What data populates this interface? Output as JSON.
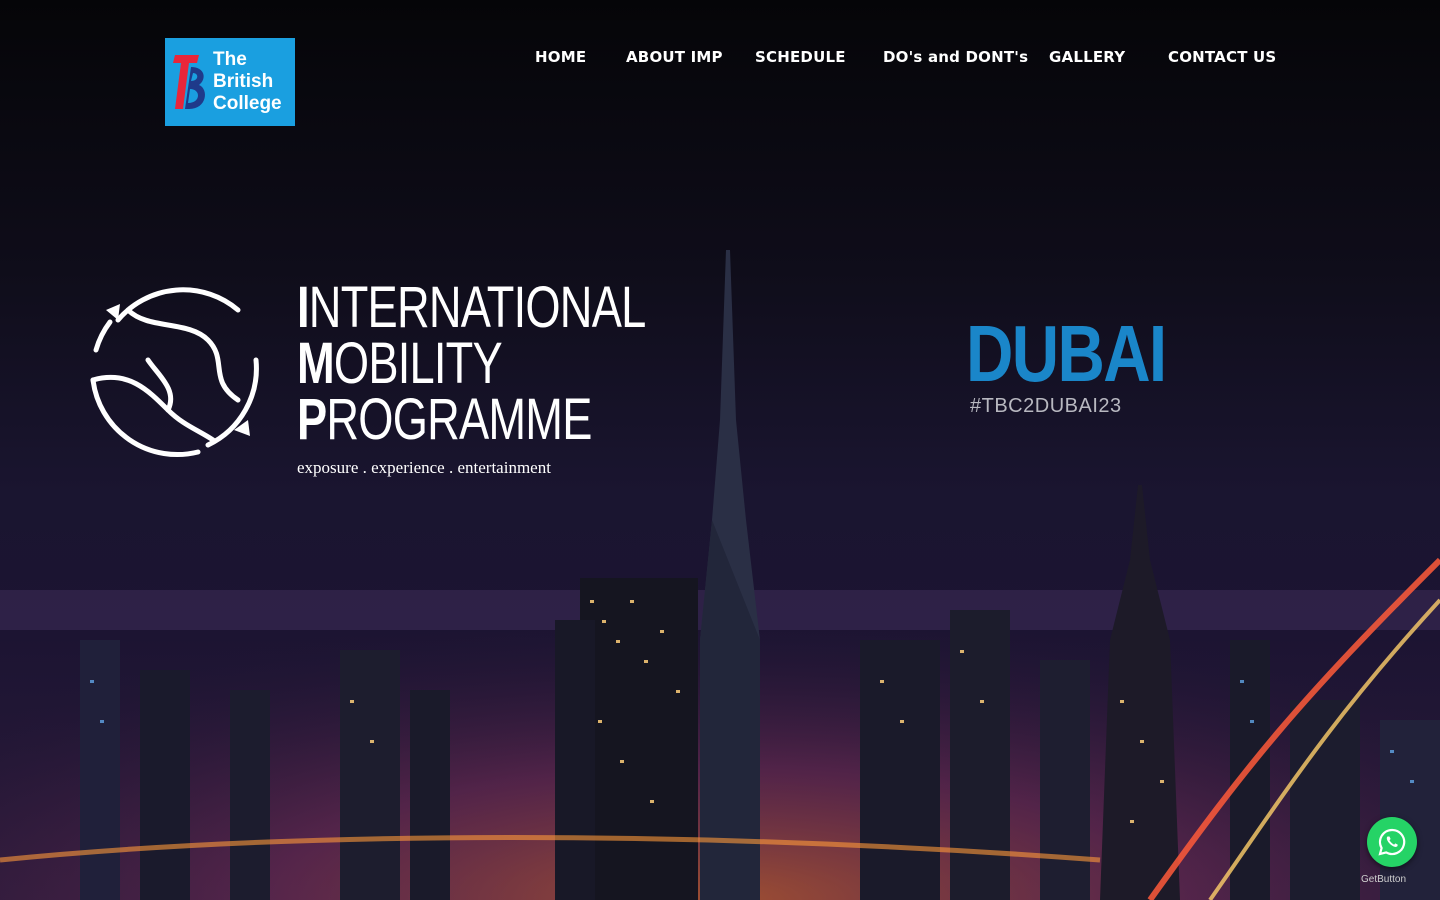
{
  "header": {
    "logo": {
      "line1": "The",
      "line2": "British",
      "line3": "College",
      "bg_color": "#1a9fe0"
    },
    "nav": [
      {
        "label": "HOME"
      },
      {
        "label": "ABOUT IMP"
      },
      {
        "label": "SCHEDULE"
      },
      {
        "label": "DO's and DONT's"
      },
      {
        "label": "GALLERY"
      },
      {
        "label": "CONTACT US"
      }
    ]
  },
  "hero": {
    "imp": {
      "line1_cap": "I",
      "line1_rest": "NTERNATIONAL",
      "line2_cap": "M",
      "line2_rest": "OBILITY",
      "line3_cap": "P",
      "line3_rest": "ROGRAMME",
      "tagline": "exposure . experience . entertainment",
      "globe_icon": "globe-arrows-icon"
    },
    "destination": {
      "title": "DUBAI",
      "hashtag": "#TBC2DUBAI23",
      "title_color": "#1a86c9"
    },
    "background": "dubai-night-skyline"
  },
  "floating": {
    "whatsapp_icon": "whatsapp-icon",
    "whatsapp_color": "#25d366",
    "getbutton_label": "GetButton"
  }
}
